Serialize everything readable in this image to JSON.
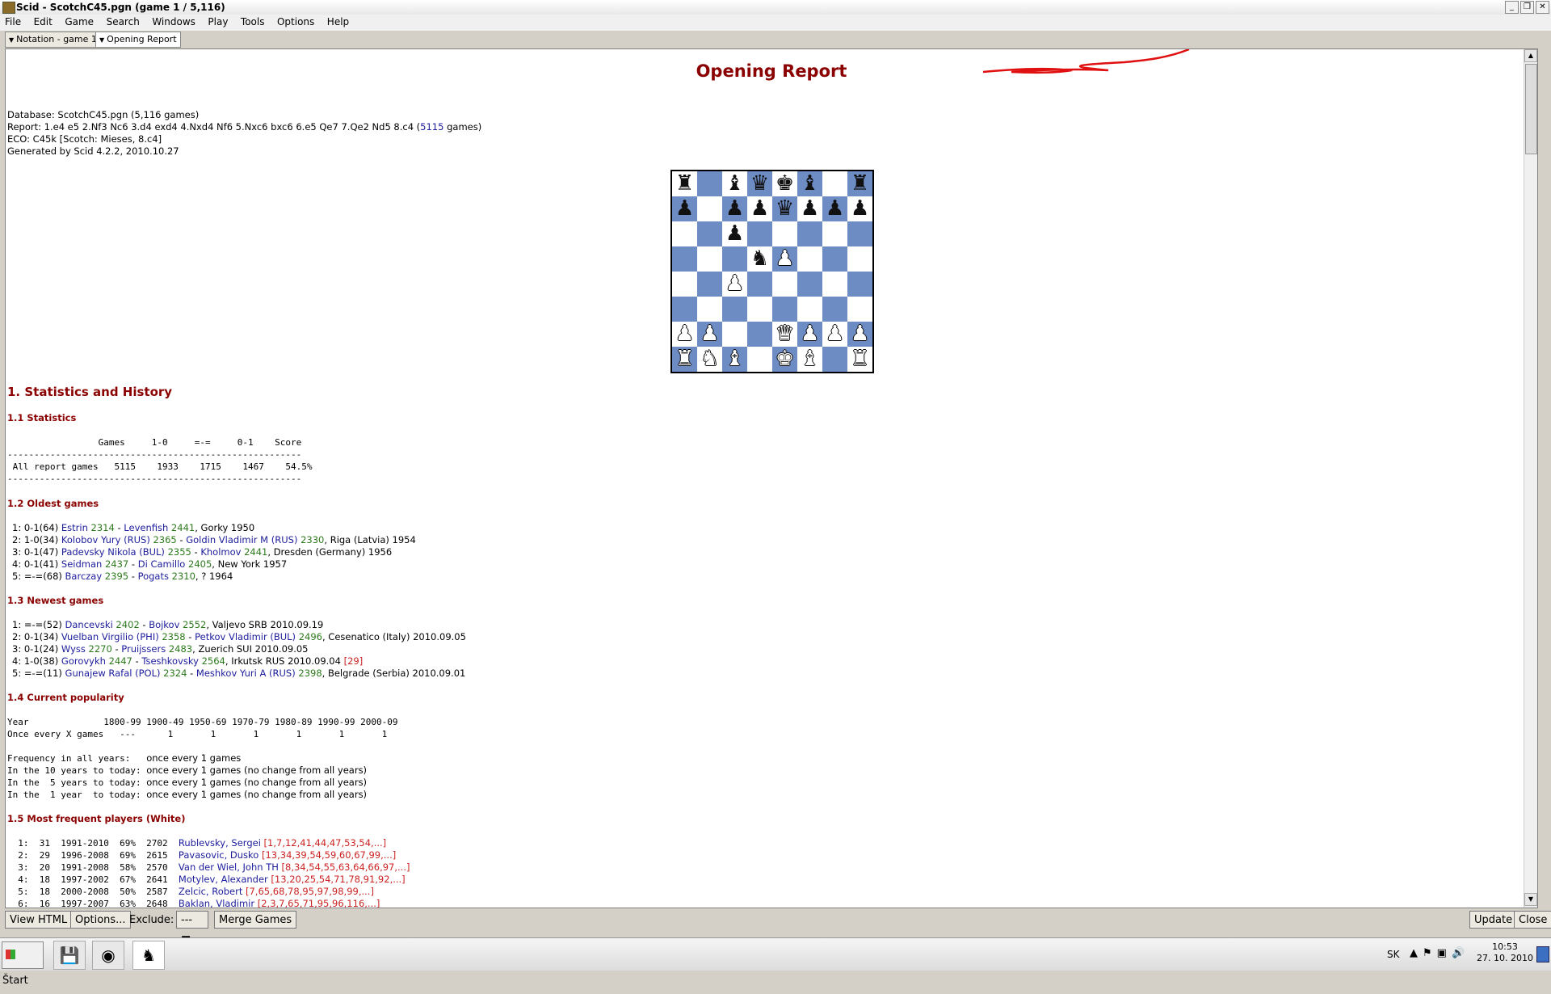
{
  "window": {
    "title": "Scid - ScotchC45.pgn (game 1 / 5,116)"
  },
  "menu": [
    "File",
    "Edit",
    "Game",
    "Search",
    "Windows",
    "Play",
    "Tools",
    "Options",
    "Help"
  ],
  "tabs": [
    "Notation - game 1",
    "Opening Report"
  ],
  "report": {
    "title": "Opening Report",
    "meta": {
      "database": "Database: ScotchC45.pgn (5,116 games)",
      "report_prefix": "Report:  1.e4 e5 2.Nf3 Nc6 3.d4 exd4 4.Nxd4 Nf6 5.Nxc6 bxc6 6.e5 Qe7 7.Qe2 Nd5 8.c4 (",
      "report_count": "5115",
      "report_suffix": " games)",
      "eco": "ECO: C45k [Scotch: Mieses, 8.c4]",
      "generated": "Generated by Scid 4.2.2, 2010.10.27"
    },
    "board": [
      "r.bqkb.r",
      "p.ppqppp",
      "..p.....",
      "...nP...",
      "..P.....",
      "........",
      "PP..QPPP",
      "RNB.KB.R"
    ],
    "sections": {
      "s1": "1. Statistics and History",
      "s11": "1.1 Statistics",
      "s12": "1.2 Oldest games",
      "s13": "1.3 Newest games",
      "s14": "1.4 Current popularity",
      "s15": "1.5 Most frequent players (White)"
    },
    "stats_table": "                 Games     1-0     =-=     0-1    Score\n-------------------------------------------------------\n All report games   5115    1933    1715    1467    54.5%\n-------------------------------------------------------",
    "oldest_games": [
      {
        "n": "1:",
        "res": "0-1(64)",
        "w": "Estrin",
        "we": "2314",
        "b": "Levenfish",
        "be": "2441",
        "place": ", Gorky 1950"
      },
      {
        "n": "2:",
        "res": "1-0(34)",
        "w": "Kolobov Yury (RUS)",
        "we": "2365",
        "b": "Goldin Vladimir M (RUS)",
        "be": "2330",
        "place": ", Riga (Latvia) 1954"
      },
      {
        "n": "3:",
        "res": "0-1(47)",
        "w": "Padevsky Nikola (BUL)",
        "we": "2355",
        "b": "Kholmov",
        "be": "2441",
        "place": ", Dresden (Germany) 1956"
      },
      {
        "n": "4:",
        "res": "0-1(41)",
        "w": "Seidman",
        "we": "2437",
        "b": "Di Camillo",
        "be": "2405",
        "place": ", New York 1957"
      },
      {
        "n": "5:",
        "res": "=-=(68)",
        "w": "Barczay",
        "we": "2395",
        "b": "Pogats",
        "be": "2310",
        "place": ", ? 1964"
      }
    ],
    "newest_games": [
      {
        "n": "1:",
        "res": "=-=(52)",
        "w": "Dancevski",
        "we": "2402",
        "b": "Bojkov",
        "be": "2552",
        "place": ", Valjevo SRB 2010.09.19",
        "ref": ""
      },
      {
        "n": "2:",
        "res": "0-1(34)",
        "w": "Vuelban Virgilio (PHI)",
        "we": "2358",
        "b": "Petkov Vladimir (BUL)",
        "be": "2496",
        "place": ", Cesenatico (Italy) 2010.09.05",
        "ref": ""
      },
      {
        "n": "3:",
        "res": "0-1(24)",
        "w": "Wyss",
        "we": "2270",
        "b": "Pruijssers",
        "be": "2483",
        "place": ", Zuerich SUI 2010.09.05",
        "ref": ""
      },
      {
        "n": "4:",
        "res": "1-0(38)",
        "w": "Gorovykh",
        "we": "2447",
        "b": "Tseshkovsky",
        "be": "2564",
        "place": ", Irkutsk RUS 2010.09.04 ",
        "ref": "[29]"
      },
      {
        "n": "5:",
        "res": "=-=(11)",
        "w": "Gunajew Rafal (POL)",
        "we": "2324",
        "b": "Meshkov Yuri A (RUS)",
        "be": "2398",
        "place": ", Belgrade (Serbia) 2010.09.01",
        "ref": ""
      }
    ],
    "popularity_table": "Year              1800-99 1900-49 1950-69 1970-79 1980-89 1990-99 2000-09\nOnce every X games   ---      1       1       1       1       1       1",
    "frequency_lines": [
      {
        "label": "Frequency in all years:   ",
        "text": "once every 1 games"
      },
      {
        "label": "In the 10 years to today: ",
        "text": "once every 1 games (no change from all years)"
      },
      {
        "label": "In the  5 years to today: ",
        "text": "once every 1 games (no change from all years)"
      },
      {
        "label": "In the  1 year  to today: ",
        "text": "once every 1 games (no change from all years)"
      }
    ],
    "players_white": [
      {
        "pre": "  1:  31  1991-2010  69%  2702  ",
        "name": "Rublevsky, Sergei",
        "refs": " [1,7,12,41,44,47,53,54,...]"
      },
      {
        "pre": "  2:  29  1996-2008  69%  2615  ",
        "name": "Pavasovic, Dusko",
        "refs": " [13,34,39,54,59,60,67,99,...]"
      },
      {
        "pre": "  3:  20  1991-2008  58%  2570  ",
        "name": "Van der Wiel, John TH",
        "refs": " [8,34,54,55,63,64,66,97,...]"
      },
      {
        "pre": "  4:  18  1997-2002  67%  2641  ",
        "name": "Motylev, Alexander",
        "refs": " [13,20,25,54,71,78,91,92,...]"
      },
      {
        "pre": "  5:  18  2000-2008  50%  2587  ",
        "name": "Zelcic, Robert",
        "refs": " [7,65,68,78,95,97,98,99,...]"
      },
      {
        "pre": "  6:  16  1997-2007  63%  2648  ",
        "name": "Baklan, Vladimir",
        "refs": " [2,3,7,65,71,95,96,116,...]"
      }
    ]
  },
  "bottom_buttons": {
    "view_html": "View HTML",
    "options": "Options...",
    "exclude_label": "Exclude:",
    "exclude_value": "---",
    "merge": "Merge Games",
    "update": "Update",
    "close": "Close"
  },
  "taskbar": {
    "start": "Štart",
    "lang": "SK",
    "time": "10:53",
    "date": "27. 10. 2010"
  },
  "colors": {
    "heading": "#8b0000",
    "player": "#1c1c9c",
    "elo": "#2c7a1c",
    "ref": "#cc2222",
    "dark_square": "#6e8cc4"
  }
}
